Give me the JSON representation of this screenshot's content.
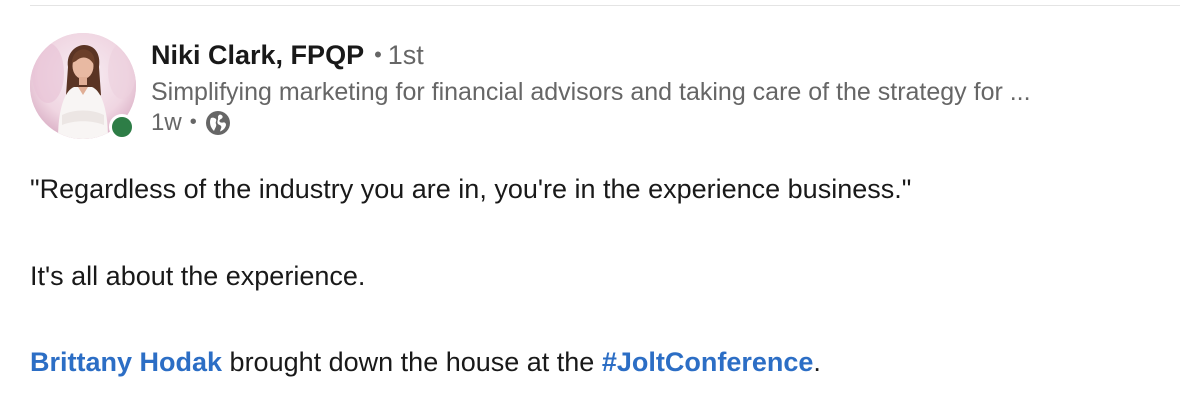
{
  "post": {
    "author": {
      "name": "Niki Clark, FPQP",
      "degree": "1st",
      "separator": "•",
      "headline": "Simplifying marketing for financial advisors and taking care of the strategy for ...",
      "online_status_color": "#2d7d46"
    },
    "timestamp": "1w",
    "time_separator": "•",
    "visibility_icon": "globe-icon",
    "body": {
      "quote": "\"Regardless of the industry you are in, you're in the experience business.\"",
      "line2": "It's all about the experience.",
      "line3": {
        "mention": "Brittany Hodak",
        "text_middle": " brought down the house at the ",
        "hashtag": "#JoltConference",
        "text_end": "."
      }
    },
    "colors": {
      "link": "#2c6ec5",
      "text_primary": "#191919",
      "text_secondary": "#666666"
    }
  }
}
